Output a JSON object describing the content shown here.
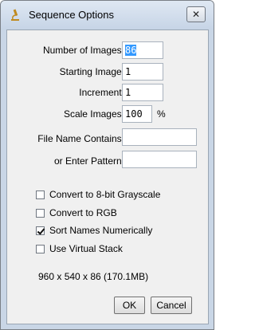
{
  "window": {
    "title": "Sequence Options",
    "close_glyph": "✕"
  },
  "fields": {
    "number_of_images": {
      "label": "Number of Images:",
      "value": "86"
    },
    "starting_image": {
      "label": "Starting Image:",
      "value": "1"
    },
    "increment": {
      "label": "Increment:",
      "value": "1"
    },
    "scale_images": {
      "label": "Scale Images:",
      "value": "100",
      "unit": "%"
    },
    "file_name_contains": {
      "label": "File Name Contains:",
      "value": ""
    },
    "enter_pattern": {
      "label": "or Enter Pattern:",
      "value": ""
    }
  },
  "checkboxes": [
    {
      "label": "Convert to 8-bit Grayscale",
      "checked": false
    },
    {
      "label": "Convert to RGB",
      "checked": false
    },
    {
      "label": "Sort Names Numerically",
      "checked": true
    },
    {
      "label": "Use Virtual Stack",
      "checked": false
    }
  ],
  "info_text": "960 x 540 x 86 (170.1MB)",
  "buttons": {
    "ok": "OK",
    "cancel": "Cancel"
  },
  "icons": {
    "app": "microscope-icon",
    "close": "close-icon"
  },
  "colors": {
    "selection": "#3399ff",
    "titlebar": "#c9d6e6"
  }
}
